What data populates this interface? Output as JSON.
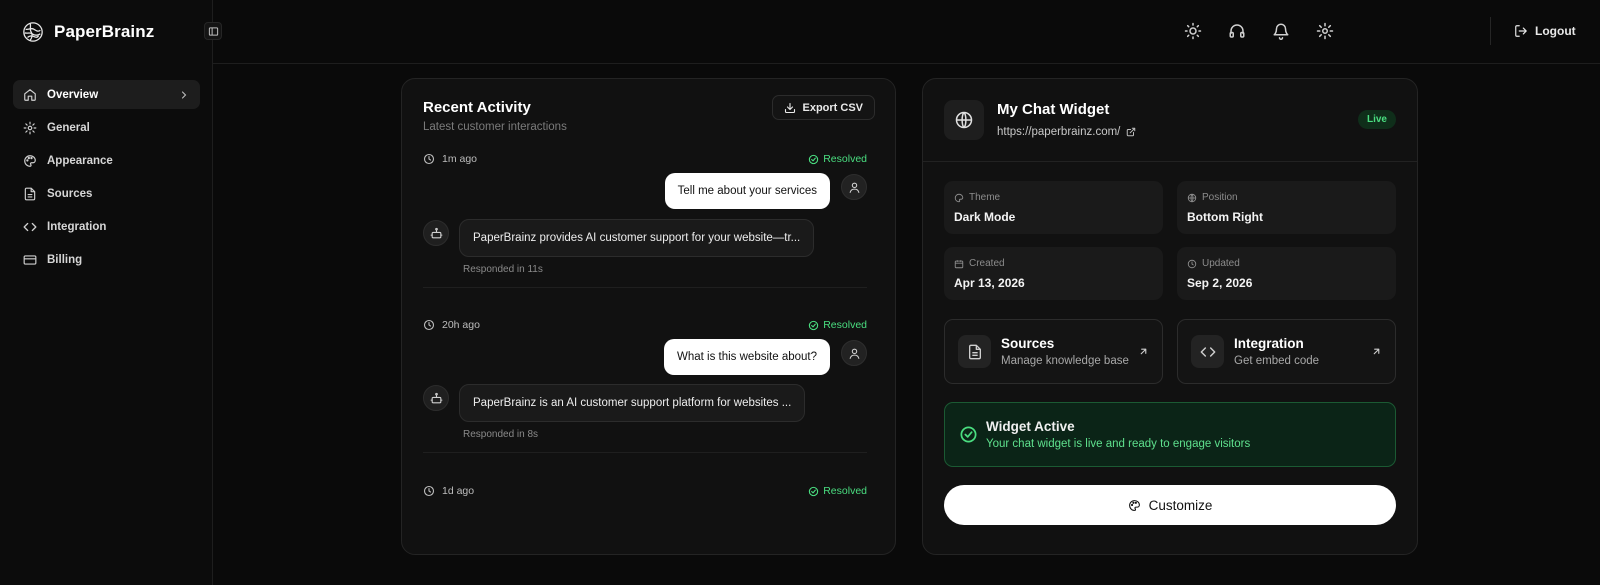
{
  "brand": {
    "name": "PaperBrainz"
  },
  "sidebar": {
    "items": [
      {
        "label": "Overview",
        "icon": "home-icon",
        "active": true
      },
      {
        "label": "General",
        "icon": "gear-icon"
      },
      {
        "label": "Appearance",
        "icon": "palette-icon"
      },
      {
        "label": "Sources",
        "icon": "file-text-icon"
      },
      {
        "label": "Integration",
        "icon": "code-icon"
      },
      {
        "label": "Billing",
        "icon": "credit-card-icon"
      }
    ]
  },
  "header": {
    "icons": [
      "sun-icon",
      "headset-icon",
      "bell-icon",
      "gear-icon"
    ],
    "logout_label": "Logout"
  },
  "activity": {
    "title": "Recent Activity",
    "subtitle": "Latest customer interactions",
    "export_label": "Export CSV",
    "entries": [
      {
        "time": "1m ago",
        "status": "Resolved",
        "user_message": "Tell me about your services",
        "bot_message": "PaperBrainz provides AI customer support for your website—tr...",
        "responded": "Responded in 11s"
      },
      {
        "time": "20h ago",
        "status": "Resolved",
        "user_message": "What is this website about?",
        "bot_message": "PaperBrainz is an AI customer support platform for websites ...",
        "responded": "Responded in 8s"
      },
      {
        "time": "1d ago",
        "status": "Resolved"
      }
    ]
  },
  "widget": {
    "title": "My Chat Widget",
    "url": "https://paperbrainz.com/",
    "badge": "Live",
    "info": [
      {
        "label": "Theme",
        "value": "Dark Mode",
        "icon": "palette-icon"
      },
      {
        "label": "Position",
        "value": "Bottom Right",
        "icon": "globe-icon"
      },
      {
        "label": "Created",
        "value": "Apr 13, 2026",
        "icon": "calendar-icon"
      },
      {
        "label": "Updated",
        "value": "Sep 2, 2026",
        "icon": "clock-icon"
      }
    ],
    "links": [
      {
        "title": "Sources",
        "subtitle": "Manage knowledge base",
        "icon": "file-text-icon"
      },
      {
        "title": "Integration",
        "subtitle": "Get embed code",
        "icon": "code-icon"
      }
    ],
    "active": {
      "title": "Widget Active",
      "subtitle": "Your chat widget is live and ready to engage visitors"
    },
    "customize_label": "Customize"
  },
  "colors": {
    "background": "#0a0a0a",
    "card": "#111111",
    "accent_green": "#4ade80",
    "active_bg": "#0b2417"
  }
}
